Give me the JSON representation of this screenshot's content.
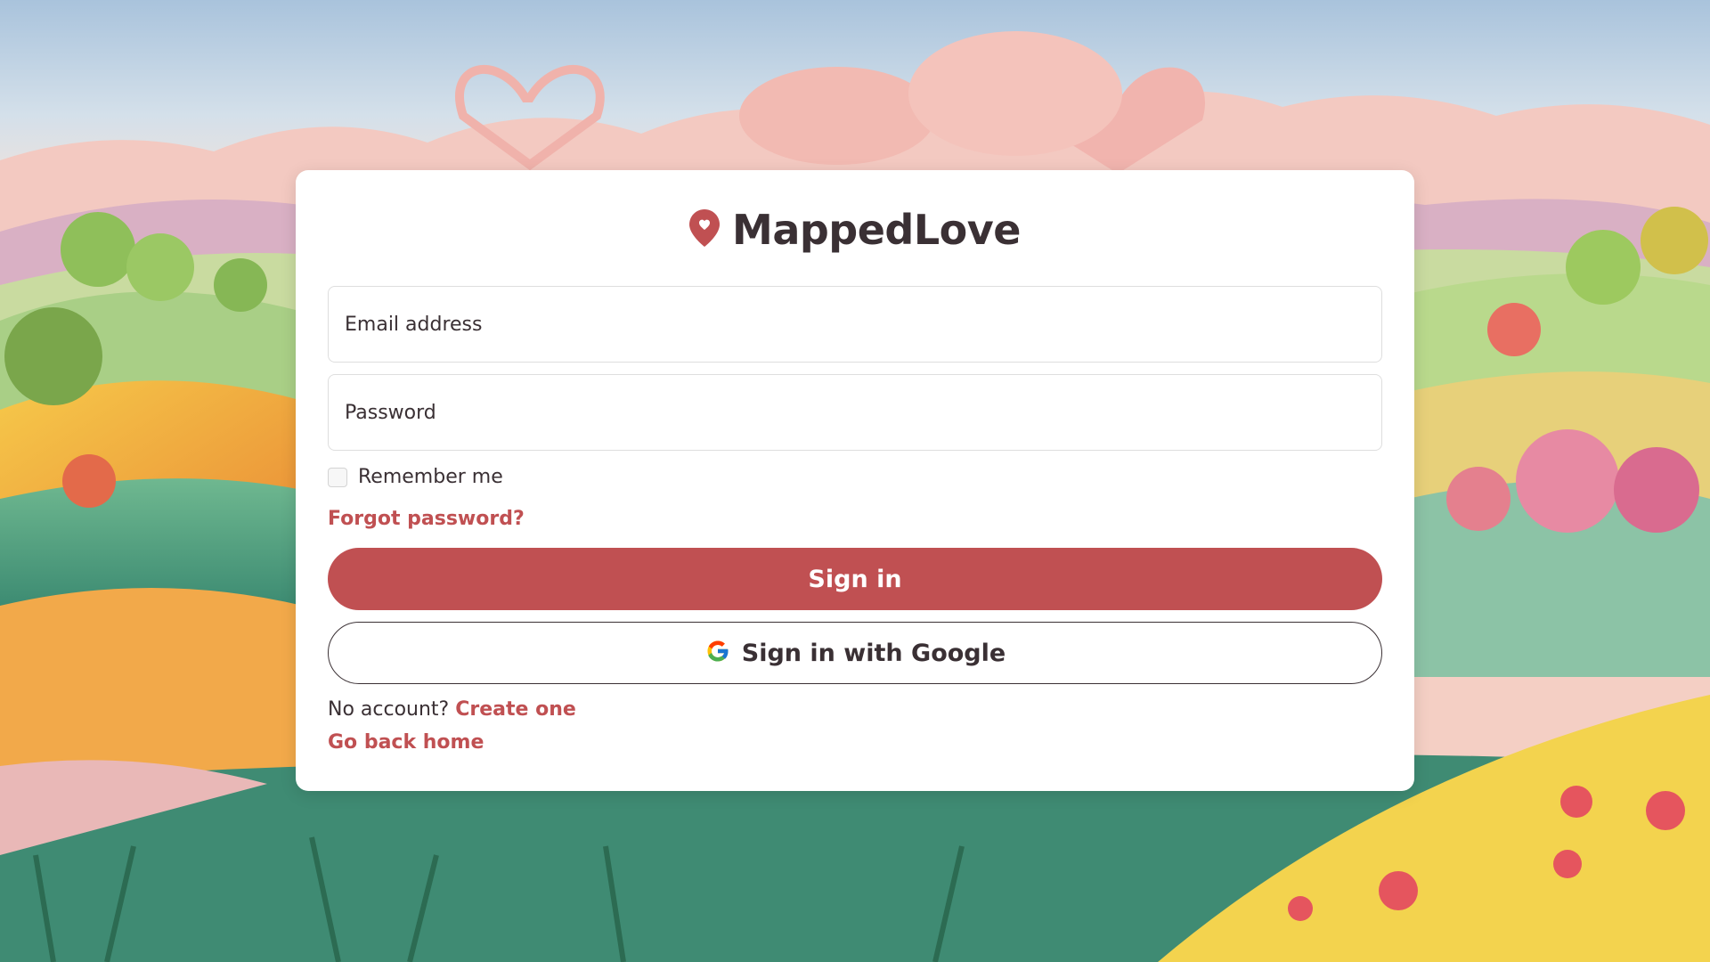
{
  "brand": {
    "name": "MappedLove",
    "icon": "map-pin-heart-icon",
    "accent_color": "#c05052"
  },
  "form": {
    "email_placeholder": "Email address",
    "password_placeholder": "Password",
    "remember_label": "Remember me",
    "forgot_label": "Forgot password?",
    "sign_in_label": "Sign in",
    "google_label": "Sign in with Google",
    "google_icon": "google-g-icon",
    "no_account_text": "No account?",
    "create_label": "Create one",
    "home_label": "Go back home"
  }
}
